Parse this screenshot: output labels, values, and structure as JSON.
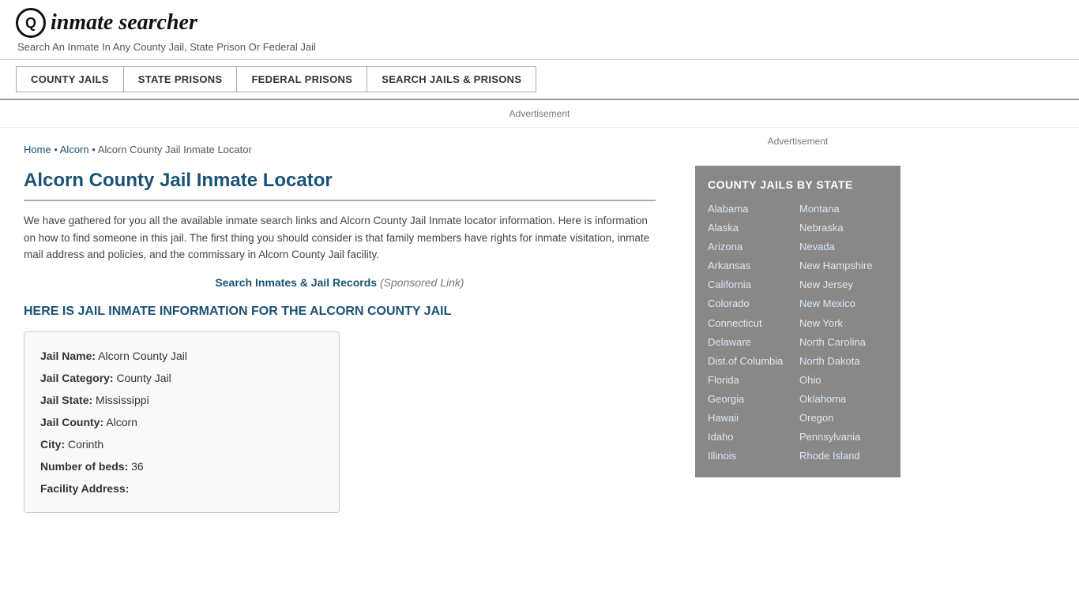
{
  "header": {
    "logo_icon": "🔍",
    "site_title": "inmate searcher",
    "tagline": "Search An Inmate In Any County Jail, State Prison Or Federal Jail"
  },
  "nav": {
    "items": [
      {
        "label": "COUNTY JAILS",
        "href": "#"
      },
      {
        "label": "STATE PRISONS",
        "href": "#"
      },
      {
        "label": "FEDERAL PRISONS",
        "href": "#"
      },
      {
        "label": "SEARCH JAILS & PRISONS",
        "href": "#"
      }
    ]
  },
  "ad_label": "Advertisement",
  "breadcrumb": {
    "home": "Home",
    "parent": "Alcorn",
    "current": "Alcorn County Jail Inmate Locator"
  },
  "page_title": "Alcorn County Jail Inmate Locator",
  "description": "We have gathered for you all the available inmate search links and Alcorn County Jail Inmate locator information. Here is information on how to find someone in this jail. The first thing you should consider is that family members have rights for inmate visitation, inmate mail address and policies, and the commissary in Alcorn County Jail facility.",
  "sponsored": {
    "link_text": "Search Inmates & Jail Records",
    "link_suffix": "(Sponsored Link)"
  },
  "section_heading": "HERE IS JAIL INMATE INFORMATION FOR THE ALCORN COUNTY JAIL",
  "info_card": {
    "fields": [
      {
        "label": "Jail Name:",
        "value": "Alcorn County Jail"
      },
      {
        "label": "Jail Category:",
        "value": "County Jail"
      },
      {
        "label": "Jail State:",
        "value": "Mississippi"
      },
      {
        "label": "Jail County:",
        "value": "Alcorn"
      },
      {
        "label": "City:",
        "value": "Corinth"
      },
      {
        "label": "Number of beds:",
        "value": "36"
      },
      {
        "label": "Facility Address:",
        "value": ""
      }
    ]
  },
  "sidebar": {
    "ad_label": "Advertisement",
    "county_jails_title": "COUNTY JAILS BY STATE",
    "states_left": [
      "Alabama",
      "Alaska",
      "Arizona",
      "Arkansas",
      "California",
      "Colorado",
      "Connecticut",
      "Delaware",
      "Dist.of Columbia",
      "Florida",
      "Georgia",
      "Hawaii",
      "Idaho",
      "Illinois"
    ],
    "states_right": [
      "Montana",
      "Nebraska",
      "Nevada",
      "New Hampshire",
      "New Jersey",
      "New Mexico",
      "New York",
      "North Carolina",
      "North Dakota",
      "Ohio",
      "Oklahoma",
      "Oregon",
      "Pennsylvania",
      "Rhode Island"
    ]
  }
}
